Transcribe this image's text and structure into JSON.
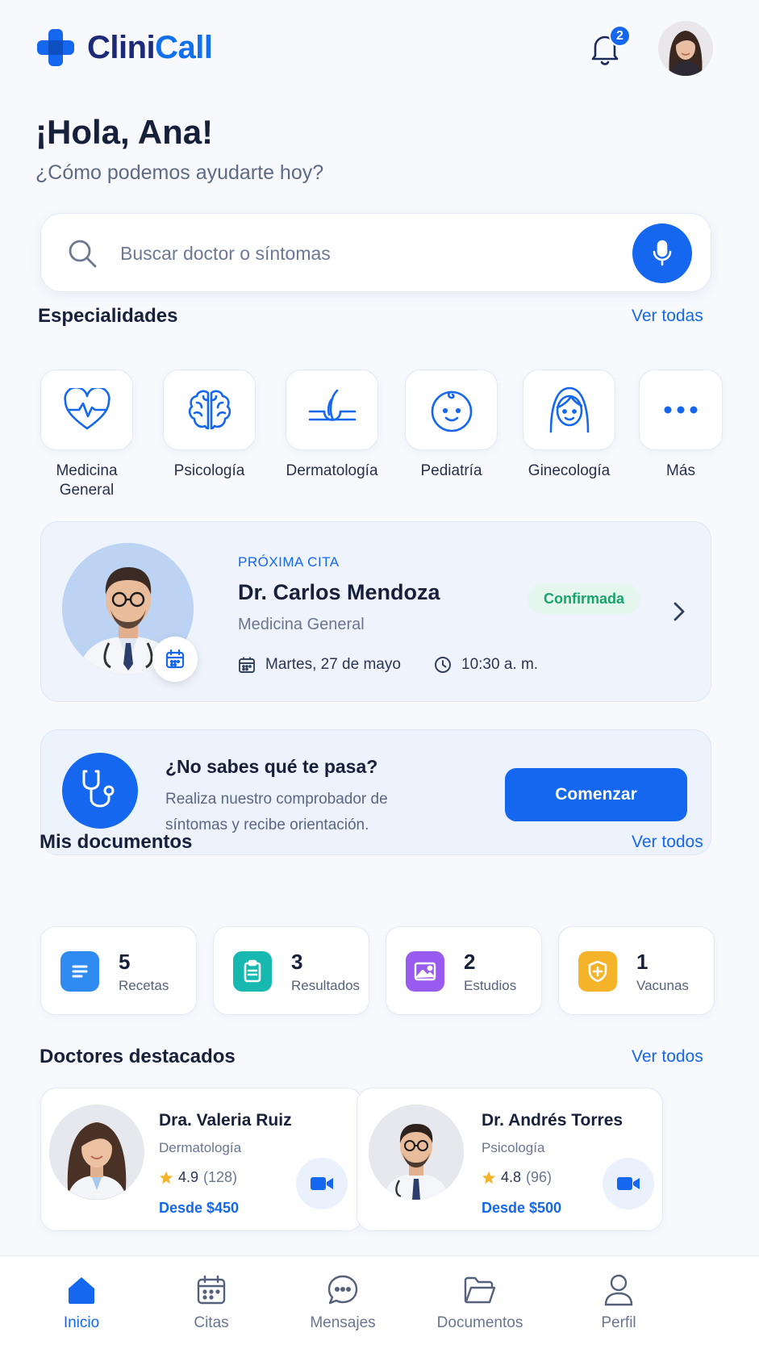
{
  "app": {
    "name_part1": "Clini",
    "name_part2": "Call",
    "notification_count": "2"
  },
  "header": {
    "greeting": "¡Hola, Ana!",
    "subtitle": "¿Cómo podemos ayudarte hoy?"
  },
  "search": {
    "placeholder": "Buscar doctor o síntomas"
  },
  "specialties": {
    "title": "Especialidades",
    "link": "Ver todas",
    "items": [
      {
        "label": "Medicina General",
        "icon": "heart-pulse-icon"
      },
      {
        "label": "Psicología",
        "icon": "brain-icon"
      },
      {
        "label": "Dermatología",
        "icon": "skin-hair-icon"
      },
      {
        "label": "Pediatría",
        "icon": "baby-face-icon"
      },
      {
        "label": "Ginecología",
        "icon": "woman-face-icon"
      },
      {
        "label": "Más",
        "icon": "more-dots-icon"
      }
    ]
  },
  "appointment": {
    "kicker": "PRÓXIMA CITA",
    "doctor": "Dr. Carlos Mendoza",
    "specialty": "Medicina General",
    "status": "Confirmada",
    "date": "Martes, 27 de mayo",
    "time": "10:30 a. m."
  },
  "checker": {
    "title": "¿No sabes qué te pasa?",
    "text": "Realiza nuestro comprobador de síntomas y recibe orientación.",
    "button": "Comenzar"
  },
  "documents": {
    "title": "Mis documentos",
    "link": "Ver todos",
    "items": [
      {
        "count": "5",
        "label": "Recetas",
        "color": "#2f8bf0"
      },
      {
        "count": "3",
        "label": "Resultados",
        "color": "#17b8b0"
      },
      {
        "count": "2",
        "label": "Estudios",
        "color": "#9a5cf0"
      },
      {
        "count": "1",
        "label": "Vacunas",
        "color": "#f5b32a"
      }
    ]
  },
  "doctors": {
    "title": "Doctores destacados",
    "link": "Ver todos",
    "items": [
      {
        "name": "Dra. Valeria Ruiz",
        "specialty": "Dermatología",
        "rating": "4.9",
        "reviews": "(128)",
        "price": "Desde $450"
      },
      {
        "name": "Dr. Andrés Torres",
        "specialty": "Psicología",
        "rating": "4.8",
        "reviews": "(96)",
        "price": "Desde $500"
      }
    ]
  },
  "nav": {
    "items": [
      {
        "label": "Inicio",
        "icon": "home-icon",
        "active": true
      },
      {
        "label": "Citas",
        "icon": "calendar-icon",
        "active": false
      },
      {
        "label": "Mensajes",
        "icon": "chat-icon",
        "active": false
      },
      {
        "label": "Documentos",
        "icon": "folder-icon",
        "active": false
      },
      {
        "label": "Perfil",
        "icon": "user-icon",
        "active": false
      }
    ]
  },
  "colors": {
    "primary": "#1467ee",
    "brand_dark": "#1d2a78",
    "success": "#17a46b"
  }
}
